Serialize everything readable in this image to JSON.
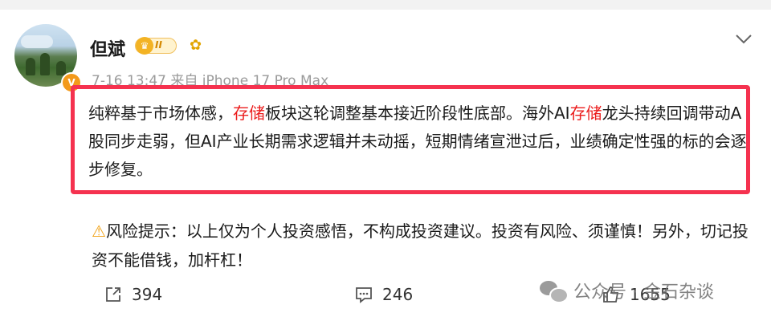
{
  "post": {
    "username": "但斌",
    "level": "II",
    "meta": "7-16 13:47 来自 iPhone 17 Pro Max",
    "text_parts": {
      "p1": "纯粹基于市场体感，",
      "h1": "存储",
      "p2": "板块这轮调整基本接近阶段性底部。海外AI",
      "h2": "存储",
      "p3": "龙头持续回调带动A股同步走弱，但AI产业长期需求逻辑并未动摇，短期情绪宣泄过后，业绩确定性强的标的会逐步修复。"
    },
    "risk_text": "风险提示：以上仅为个人投资感悟，不构成投资建议。投资有风险、须谨慎！另外，切记投资不能借钱，加杆杠！",
    "icons": {
      "verified": "verified-v-badge",
      "level": "crown-level-badge",
      "emoji": "sunflower-icon",
      "more": "chevron-down-icon",
      "warning": "warning-icon"
    },
    "colors": {
      "highlight_border": "#f5324f",
      "keyword": "#eb1c1c"
    }
  },
  "actions": {
    "repost_count": "394",
    "comment_count": "246",
    "like_count": "1655"
  },
  "watermark": {
    "text": "公众号 · 金石杂谈"
  }
}
